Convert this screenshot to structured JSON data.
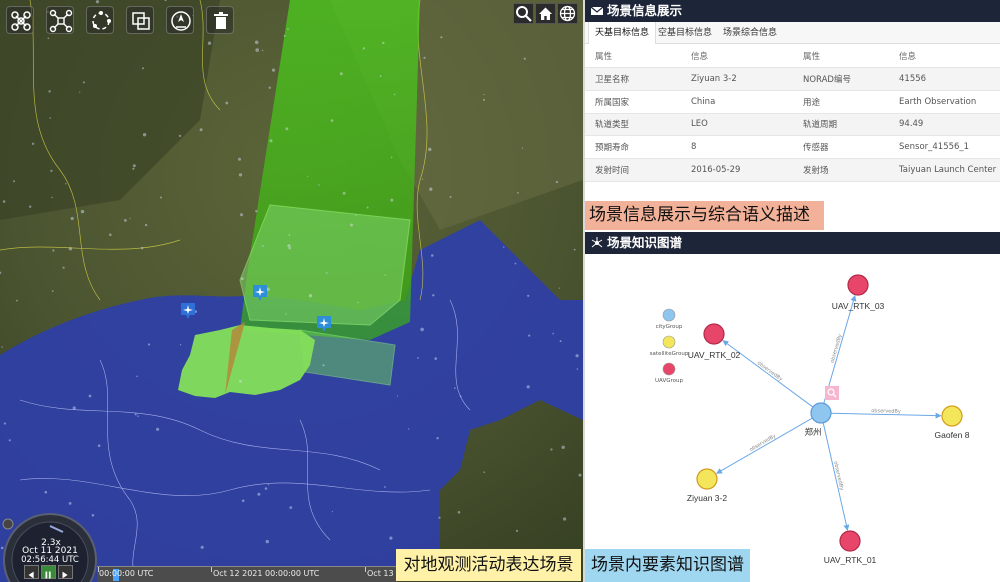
{
  "map": {
    "toolbar": [
      {
        "icon": "uav-icon"
      },
      {
        "icon": "drone-network-icon"
      },
      {
        "icon": "orbit-icon"
      },
      {
        "icon": "layers-icon"
      },
      {
        "icon": "compass-icon"
      },
      {
        "icon": "trash-icon"
      }
    ],
    "topright": [
      {
        "icon": "search-icon"
      },
      {
        "icon": "home-icon"
      },
      {
        "icon": "globe-icon"
      }
    ],
    "clock": {
      "speed": "2.3x",
      "date": "Oct 11 2021",
      "time": "02:56:44 UTC"
    },
    "timeline": {
      "labels": [
        "00:00:00 UTC",
        "Oct 12 2021 00:00:00 UTC",
        "Oct 13"
      ]
    },
    "caption": "对地观测活动表达场景"
  },
  "info": {
    "header": "场景信息展示",
    "tabs": [
      "天基目标信息",
      "空基目标信息",
      "场景综合信息"
    ],
    "table": {
      "headers": [
        "属性",
        "信息",
        "属性",
        "信息"
      ],
      "rows": [
        [
          "卫星名称",
          "Ziyuan 3-2",
          "NORAD编号",
          "41556"
        ],
        [
          "所属国家",
          "China",
          "用途",
          "Earth Observation"
        ],
        [
          "轨道类型",
          "LEO",
          "轨道周期",
          "94.49"
        ],
        [
          "预期寿命",
          "8",
          "传感器",
          "Sensor_41556_1"
        ],
        [
          "发射时间",
          "2016-05-29",
          "发射场",
          "Taiyuan Launch Center"
        ]
      ]
    },
    "caption_top": "场景信息展示与综合语义描述"
  },
  "graph": {
    "header": "场景知识图谱",
    "legend": [
      {
        "label": "cityGroup",
        "color": "#8ec6ef"
      },
      {
        "label": "satelliteGroup",
        "color": "#f3e65a"
      },
      {
        "label": "UAVGroup",
        "color": "#e8456a"
      }
    ],
    "nodes": [
      {
        "id": "zhengzhou",
        "label": "郑州",
        "group": "city"
      },
      {
        "id": "uav03",
        "label": "UAV_RTK_03",
        "group": "uav"
      },
      {
        "id": "uav02",
        "label": "UAV_RTK_02",
        "group": "uav"
      },
      {
        "id": "uav01",
        "label": "UAV_RTK_01",
        "group": "uav"
      },
      {
        "id": "gaofen8",
        "label": "Gaofen 8",
        "group": "satellite"
      },
      {
        "id": "ziyuan32",
        "label": "Ziyuan 3-2",
        "group": "satellite"
      }
    ],
    "edges": [
      {
        "from": "zhengzhou",
        "to": "uav03",
        "label": "observedBy"
      },
      {
        "from": "zhengzhou",
        "to": "gaofen8",
        "label": "observedBy"
      },
      {
        "from": "zhengzhou",
        "to": "ziyuan32",
        "label": "observedBy"
      },
      {
        "from": "zhengzhou",
        "to": "uav01",
        "label": "observedBy"
      },
      {
        "from": "zhengzhou",
        "to": "uav02",
        "label": "observedBy"
      }
    ],
    "caption": "场景内要素知识图谱"
  }
}
